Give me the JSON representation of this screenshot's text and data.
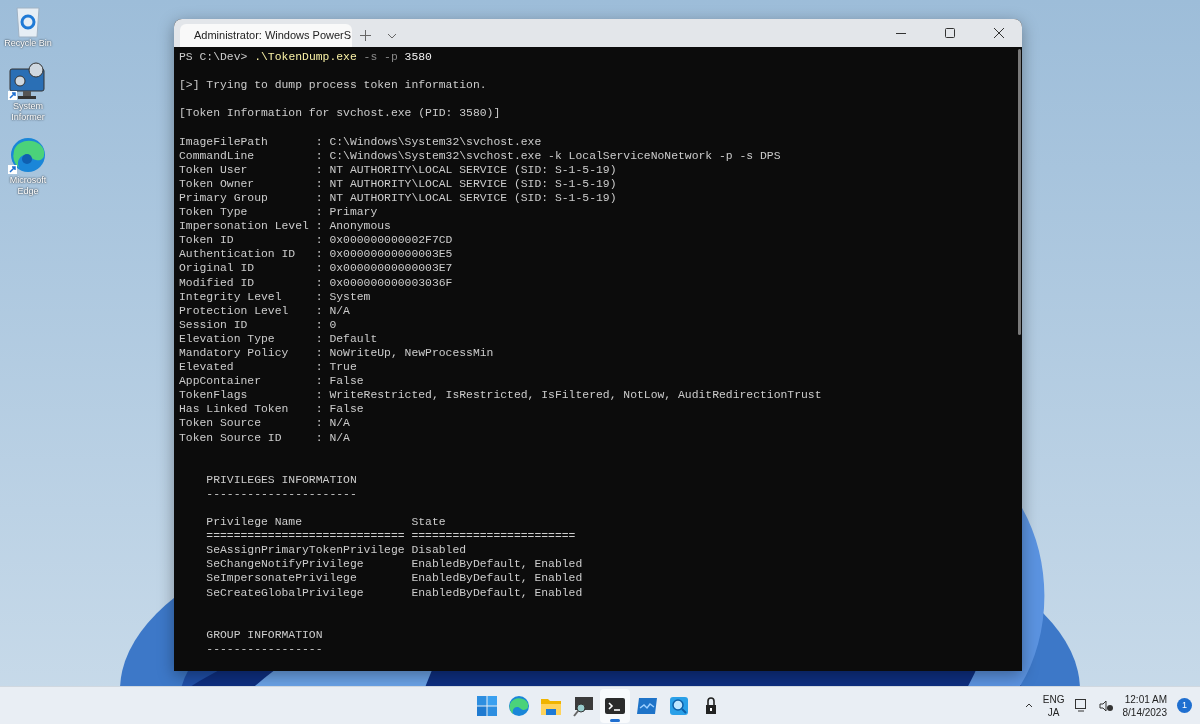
{
  "desktop_icons": [
    {
      "kind": "recycle",
      "label": "Recycle Bin"
    },
    {
      "kind": "system",
      "label": "System Informer"
    },
    {
      "kind": "edge",
      "label": "Microsoft Edge"
    }
  ],
  "window": {
    "tab": {
      "title": "Administrator: Windows PowerS",
      "selected": true
    },
    "lines": [
      {
        "kind": "prompt",
        "prompt": "PS C:\\Dev> ",
        "command": ".\\TokenDump.exe",
        "args": " -s -p ",
        "value": "3580"
      },
      {
        "kind": "blank"
      },
      {
        "kind": "text",
        "text": "[>] Trying to dump process token information."
      },
      {
        "kind": "blank"
      },
      {
        "kind": "text",
        "text": "[Token Information for svchost.exe (PID: 3580)]"
      },
      {
        "kind": "blank"
      },
      {
        "kind": "text",
        "text": "ImageFilePath       : C:\\Windows\\System32\\svchost.exe"
      },
      {
        "kind": "text",
        "text": "CommandLine         : C:\\Windows\\System32\\svchost.exe -k LocalServiceNoNetwork -p -s DPS"
      },
      {
        "kind": "text",
        "text": "Token User          : NT AUTHORITY\\LOCAL SERVICE (SID: S-1-5-19)"
      },
      {
        "kind": "text",
        "text": "Token Owner         : NT AUTHORITY\\LOCAL SERVICE (SID: S-1-5-19)"
      },
      {
        "kind": "text",
        "text": "Primary Group       : NT AUTHORITY\\LOCAL SERVICE (SID: S-1-5-19)"
      },
      {
        "kind": "text",
        "text": "Token Type          : Primary"
      },
      {
        "kind": "text",
        "text": "Impersonation Level : Anonymous"
      },
      {
        "kind": "text",
        "text": "Token ID            : 0x000000000002F7CD"
      },
      {
        "kind": "text",
        "text": "Authentication ID   : 0x00000000000003E5"
      },
      {
        "kind": "text",
        "text": "Original ID         : 0x00000000000003E7"
      },
      {
        "kind": "text",
        "text": "Modified ID         : 0x000000000003036F"
      },
      {
        "kind": "text",
        "text": "Integrity Level     : System"
      },
      {
        "kind": "text",
        "text": "Protection Level    : N/A"
      },
      {
        "kind": "text",
        "text": "Session ID          : 0"
      },
      {
        "kind": "text",
        "text": "Elevation Type      : Default"
      },
      {
        "kind": "text",
        "text": "Mandatory Policy    : NoWriteUp, NewProcessMin"
      },
      {
        "kind": "text",
        "text": "Elevated            : True"
      },
      {
        "kind": "text",
        "text": "AppContainer        : False"
      },
      {
        "kind": "text",
        "text": "TokenFlags          : WriteRestricted, IsRestricted, IsFiltered, NotLow, AuditRedirectionTrust"
      },
      {
        "kind": "text",
        "text": "Has Linked Token    : False"
      },
      {
        "kind": "text",
        "text": "Token Source        : N/A"
      },
      {
        "kind": "text",
        "text": "Token Source ID     : N/A"
      },
      {
        "kind": "blank"
      },
      {
        "kind": "blank"
      },
      {
        "kind": "text",
        "text": "    PRIVILEGES INFORMATION"
      },
      {
        "kind": "text",
        "text": "    ----------------------"
      },
      {
        "kind": "blank"
      },
      {
        "kind": "text",
        "text": "    Privilege Name                State"
      },
      {
        "kind": "text",
        "text": "    ============================= ========================"
      },
      {
        "kind": "text",
        "text": "    SeAssignPrimaryTokenPrivilege Disabled"
      },
      {
        "kind": "text",
        "text": "    SeChangeNotifyPrivilege       EnabledByDefault, Enabled"
      },
      {
        "kind": "text",
        "text": "    SeImpersonatePrivilege        EnabledByDefault, Enabled"
      },
      {
        "kind": "text",
        "text": "    SeCreateGlobalPrivilege       EnabledByDefault, Enabled"
      },
      {
        "kind": "blank"
      },
      {
        "kind": "blank"
      },
      {
        "kind": "text",
        "text": "    GROUP INFORMATION"
      },
      {
        "kind": "text",
        "text": "    -----------------"
      }
    ]
  },
  "taskbar": {
    "apps": [
      {
        "kind": "start",
        "selected": false
      },
      {
        "kind": "edge",
        "selected": false
      },
      {
        "kind": "folder",
        "selected": false
      },
      {
        "kind": "remote",
        "selected": false
      },
      {
        "kind": "terminal",
        "selected": true
      },
      {
        "kind": "monitor",
        "selected": false
      },
      {
        "kind": "magnifier",
        "selected": false
      },
      {
        "kind": "lock",
        "selected": false
      }
    ],
    "tray": {
      "language": "ENG",
      "input": "JA",
      "time": "12:01 AM",
      "date": "8/14/2023",
      "notifications": "1"
    }
  }
}
